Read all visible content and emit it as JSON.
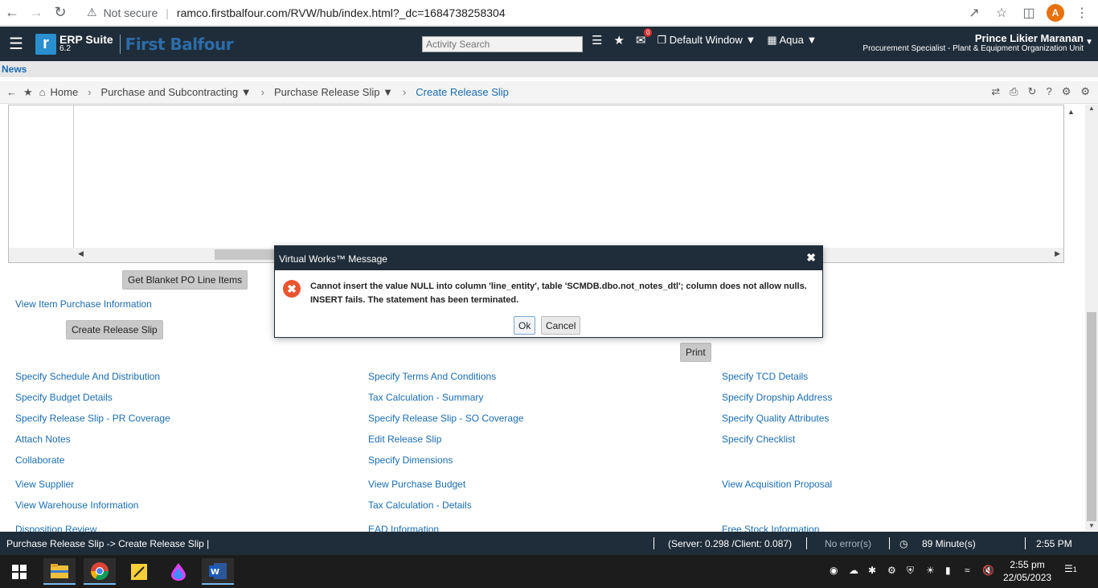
{
  "browser": {
    "security": "Not secure",
    "url": "ramco.firstbalfour.com/RVW/hub/index.html?_dc=1684738258304",
    "avatar_letter": "A"
  },
  "header": {
    "logo_letter": "r",
    "suite_name": "ERP Suite",
    "suite_version": "6.2",
    "brand": "First Balfour",
    "activity_search_placeholder": "Activity Search",
    "notification_count": "0",
    "window_label": "Default Window",
    "theme_label": "Aqua",
    "user_name": "Prince Likier Maranan",
    "user_role": "Procurement Specialist - Plant & Equipment Organization Unit"
  },
  "news": {
    "label": "News"
  },
  "breadcrumb": {
    "home": "Home",
    "items": [
      "Purchase and Subcontracting",
      "Purchase Release Slip"
    ],
    "current": "Create Release Slip"
  },
  "actions": {
    "get_blanket": "Get Blanket PO Line Items",
    "view_item_purchase": "View Item Purchase Information",
    "create_release_slip": "Create Release Slip",
    "print": "Print"
  },
  "links": {
    "col1": [
      "Specify Schedule And Distribution",
      "Specify Budget Details",
      "Specify Release Slip - PR Coverage",
      "Attach Notes",
      "Collaborate",
      "View Supplier",
      "View Warehouse Information",
      "Disposition Review"
    ],
    "col2": [
      "Specify Terms And Conditions",
      "Tax Calculation - Summary",
      "Specify Release Slip - SO Coverage",
      "Edit Release Slip",
      "Specify Dimensions",
      "View Purchase Budget",
      "Tax Calculation - Details",
      "EAD Information"
    ],
    "col3": [
      "Specify TCD Details",
      "Specify Dropship Address",
      "Specify Quality Attributes",
      "Specify Checklist",
      "View Acquisition Proposal",
      "Free Stock Information"
    ]
  },
  "dialog": {
    "title": "Virtual Works™ Message",
    "message_line1": "Cannot insert the value NULL into column 'line_entity', table 'SCMDB.dbo.not_notes_dtl'; column does not allow nulls.",
    "message_line2": "INSERT fails. The statement has been terminated.",
    "ok": "Ok",
    "cancel": "Cancel"
  },
  "status": {
    "path": "Purchase Release Slip -> Create Release Slip |",
    "timing": "(Server: 0.298 /Client: 0.087)",
    "errors": "No error(s)",
    "session": "89 Minute(s)",
    "time": "2:55 PM"
  },
  "taskbar": {
    "time": "2:55 pm",
    "date": "22/05/2023",
    "notification_count": "1"
  }
}
